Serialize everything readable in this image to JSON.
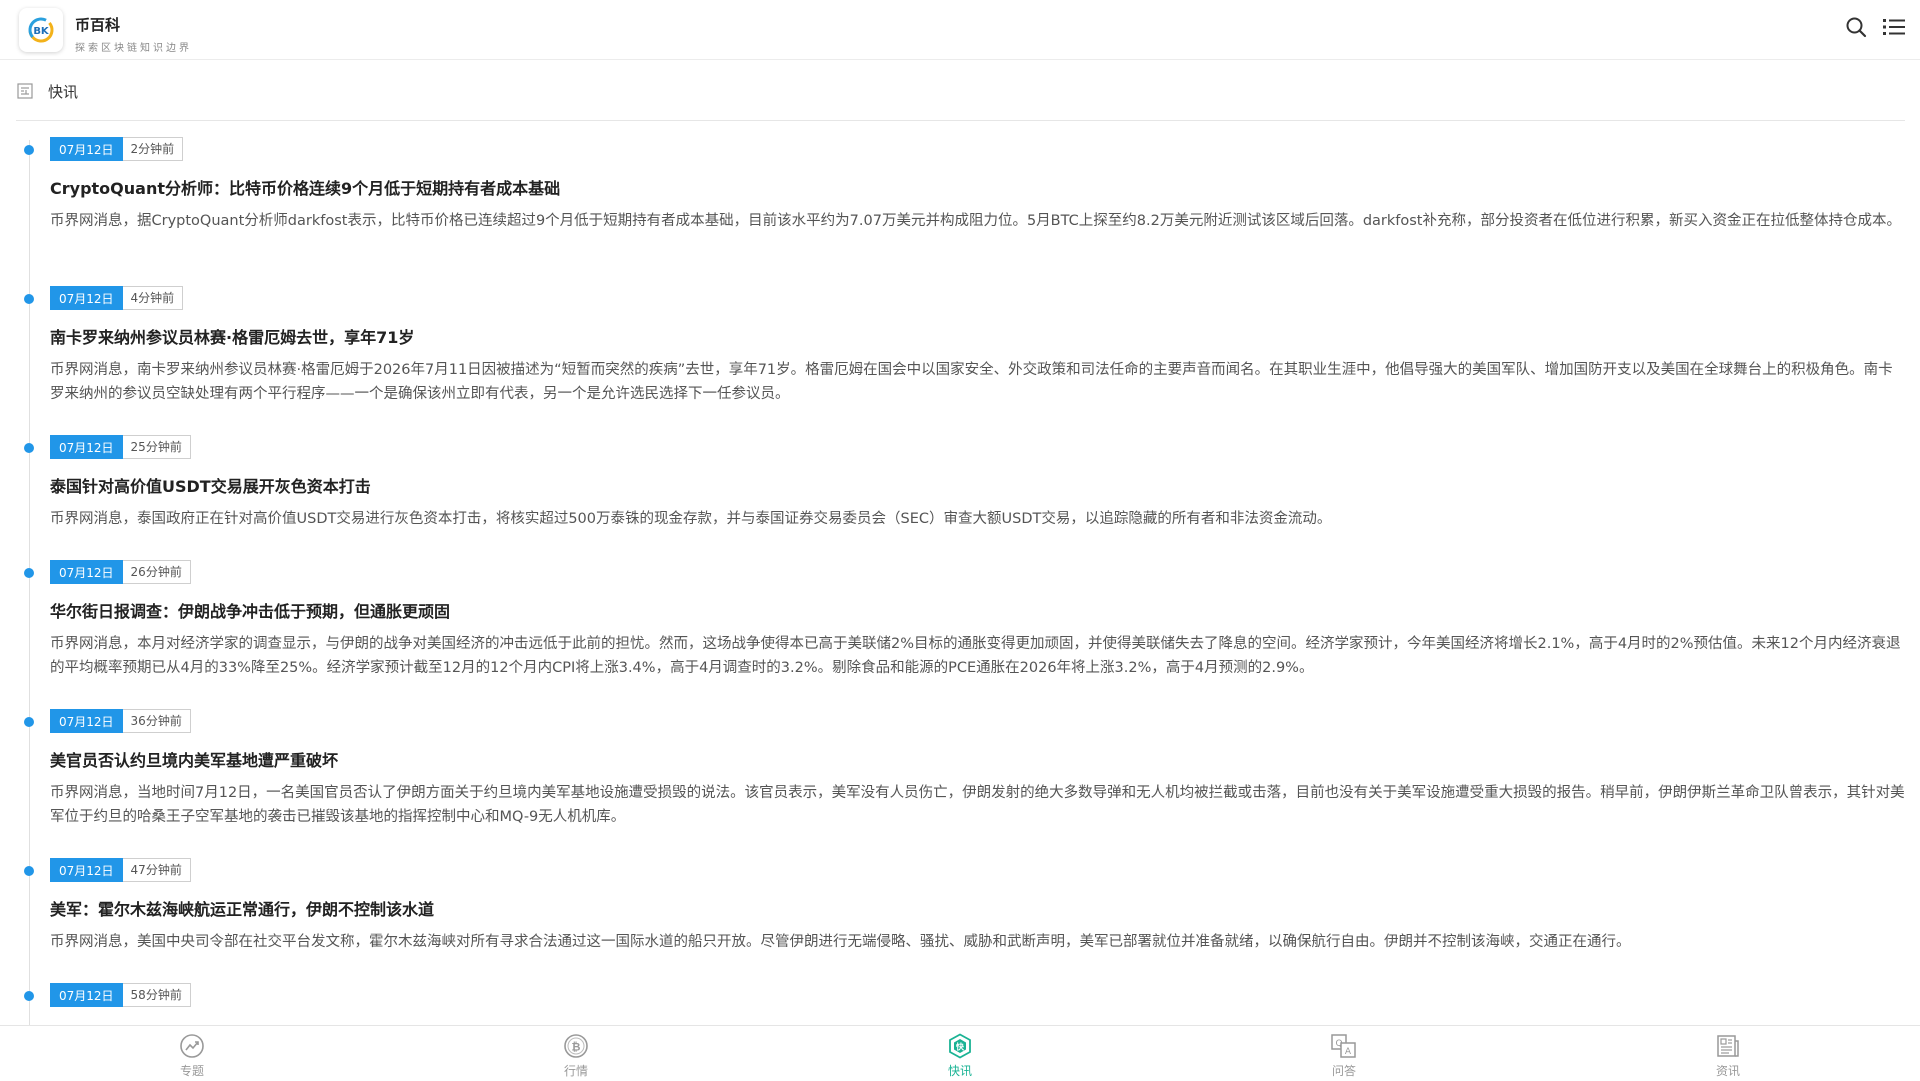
{
  "header": {
    "title": "币百科",
    "subtitle": "探索区块链知识边界",
    "logo_text": "BK",
    "search_icon": "search-icon",
    "menu_icon": "list-menu-icon"
  },
  "section": {
    "title": "快讯",
    "icon": "newspaper-outline-icon"
  },
  "feed": [
    {
      "date": "07月12日",
      "ago": "2分钟前",
      "title": "CryptoQuant分析师：比特币价格连续9个月低于短期持有者成本基础",
      "body": "币界网消息，据CryptoQuant分析师darkfost表示，比特币价格已连续超过9个月低于短期持有者成本基础，目前该水平约为7.07万美元并构成阻力位。5月BTC上探至约8.2万美元附近测试该区域后回落。darkfost补充称，部分投资者在低位进行积累，新买入资金正在拉低整体持仓成本。"
    },
    {
      "date": "07月12日",
      "ago": "4分钟前",
      "title": "南卡罗来纳州参议员林赛·格雷厄姆去世，享年71岁",
      "body": "币界网消息，南卡罗来纳州参议员林赛·格雷厄姆于2026年7月11日因被描述为“短暂而突然的疾病”去世，享年71岁。格雷厄姆在国会中以国家安全、外交政策和司法任命的主要声音而闻名。在其职业生涯中，他倡导强大的美国军队、增加国防开支以及美国在全球舞台上的积极角色。南卡罗来纳州的参议员空缺处理有两个平行程序——一个是确保该州立即有代表，另一个是允许选民选择下一任参议员。"
    },
    {
      "date": "07月12日",
      "ago": "25分钟前",
      "title": "泰国针对高价值USDT交易展开灰色资本打击",
      "body": "币界网消息，泰国政府正在针对高价值USDT交易进行灰色资本打击，将核实超过500万泰铢的现金存款，并与泰国证券交易委员会（SEC）审查大额USDT交易，以追踪隐藏的所有者和非法资金流动。"
    },
    {
      "date": "07月12日",
      "ago": "26分钟前",
      "title": "华尔街日报调查：伊朗战争冲击低于预期，但通胀更顽固",
      "body": "币界网消息，本月对经济学家的调查显示，与伊朗的战争对美国经济的冲击远低于此前的担忧。然而，这场战争使得本已高于美联储2%目标的通胀变得更加顽固，并使得美联储失去了降息的空间。经济学家预计，今年美国经济将增长2.1%，高于4月时的2%预估值。未来12个月内经济衰退的平均概率预期已从4月的33%降至25%。经济学家预计截至12月的12个月内CPI将上涨3.4%，高于4月调查时的3.2%。剔除食品和能源的PCE通胀在2026年将上涨3.2%，高于4月预测的2.9%。"
    },
    {
      "date": "07月12日",
      "ago": "36分钟前",
      "title": "美官员否认约旦境内美军基地遭严重破坏",
      "body": "币界网消息，当地时间7月12日，一名美国官员否认了伊朗方面关于约旦境内美军基地设施遭受损毁的说法。该官员表示，美军没有人员伤亡，伊朗发射的绝大多数导弹和无人机均被拦截或击落，目前也没有关于美军设施遭受重大损毁的报告。稍早前，伊朗伊斯兰革命卫队曾表示，其针对美军位于约旦的哈桑王子空军基地的袭击已摧毁该基地的指挥控制中心和MQ-9无人机机库。"
    },
    {
      "date": "07月12日",
      "ago": "47分钟前",
      "title": "美军：霍尔木兹海峡航运正常通行，伊朗不控制该水道",
      "body": "币界网消息，美国中央司令部在社交平台发文称，霍尔木兹海峡对所有寻求合法通过这一国际水道的船只开放。尽管伊朗进行无端侵略、骚扰、威胁和武断声明，美军已部署就位并准备就绪，以确保航行自由。伊朗并不控制该海峡，交通正在通行。"
    },
    {
      "date": "07月12日",
      "ago": "58分钟前",
      "title": "",
      "body": ""
    }
  ],
  "bottom_nav": [
    {
      "label": "专题",
      "icon": "trend-circle-icon",
      "active": false
    },
    {
      "label": "行情",
      "icon": "bitcoin-coin-icon",
      "active": false
    },
    {
      "label": "快讯",
      "icon": "flash-hexagon-icon",
      "active": true
    },
    {
      "label": "问答",
      "icon": "qa-icon",
      "active": false
    },
    {
      "label": "资讯",
      "icon": "newspaper-icon",
      "active": false
    }
  ],
  "colors": {
    "accent": "#2196e8",
    "nav_active": "#1ab394",
    "nav_inactive": "#999999"
  }
}
